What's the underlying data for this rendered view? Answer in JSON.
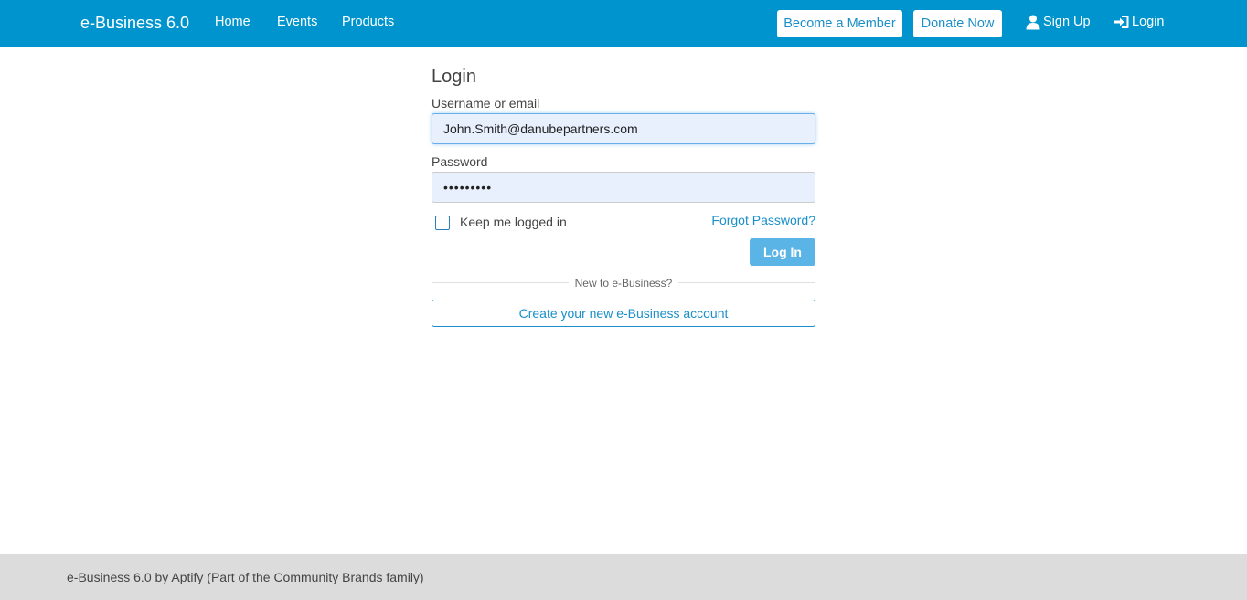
{
  "header": {
    "brand": "e-Business 6.0",
    "nav": {
      "home": "Home",
      "events": "Events",
      "products": "Products"
    },
    "become_member": "Become a Member",
    "donate_now": "Donate Now",
    "sign_up": "Sign Up",
    "login": "Login",
    "icons": {
      "sign_up": "user-icon",
      "login": "sign-in-icon"
    }
  },
  "login_form": {
    "title": "Login",
    "username_label": "Username or email",
    "username_value": "John.Smith@danubepartners.com",
    "password_label": "Password",
    "password_value": "•••••••••",
    "keep_logged_in": "Keep me logged in",
    "forgot_password": "Forgot Password?",
    "submit": "Log In",
    "divider_text": "New to e-Business?",
    "create_account": "Create your new e-Business account"
  },
  "footer": {
    "text": "e-Business 6.0 by Aptify (Part of the Community Brands family)"
  },
  "colors": {
    "navbar": "#0094ce",
    "accent": "#1a8fc9",
    "login_button": "#5ab4e5",
    "input_background": "#e8f0fe",
    "footer": "#dcdcdc"
  }
}
